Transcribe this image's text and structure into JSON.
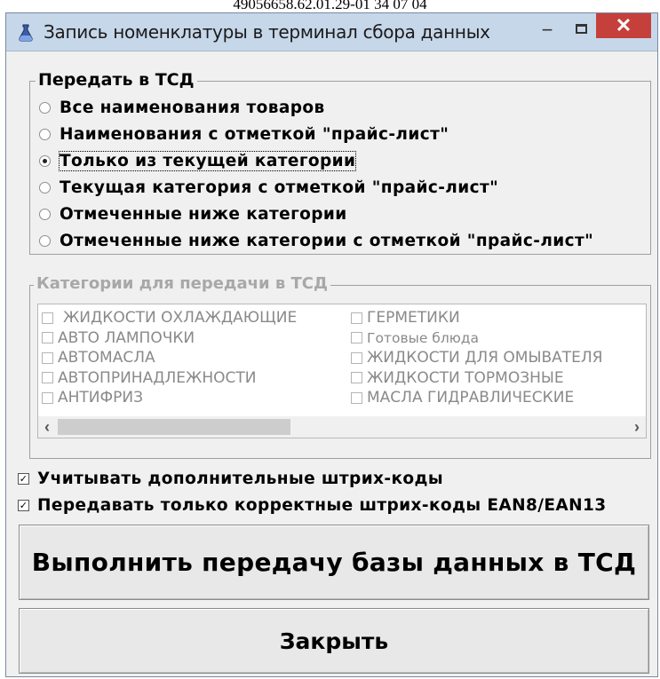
{
  "caption": "49056658.62.01.29-01 34 07 04",
  "window": {
    "title": "Запись номенклатуры в терминал сбора данных",
    "minimize_glyph": "−",
    "close_glyph": "✕",
    "app_icon": "flask-icon"
  },
  "transfer_group": {
    "legend": "Передать в ТСД",
    "options": [
      {
        "label": "Все наименования товаров",
        "selected": false
      },
      {
        "label": "Наименования с отметкой \"прайс-лист\"",
        "selected": false
      },
      {
        "label": "Только из текущей категории",
        "selected": true
      },
      {
        "label": "Текущая категория с отметкой \"прайс-лист\"",
        "selected": false
      },
      {
        "label": "Отмеченные ниже категории",
        "selected": false
      },
      {
        "label": "Отмеченные ниже категории с отметкой \"прайс-лист\"",
        "selected": false
      }
    ]
  },
  "categories_group": {
    "legend": "Категории для передачи в ТСД",
    "column1": [
      "ЖИДКОСТИ ОХЛАЖДАЮЩИЕ",
      "АВТО ЛАМПОЧКИ",
      "АВТОМАСЛА",
      "АВТОПРИНАДЛЕЖНОСТИ",
      "АНТИФРИЗ"
    ],
    "column2": [
      "ГЕРМЕТИКИ",
      "Готовые блюда",
      "ЖИДКОСТИ ДЛЯ ОМЫВАТЕЛЯ",
      "ЖИДКОСТИ ТОРМОЗНЫЕ",
      "МАСЛА ГИДРАВЛИЧЕСКИЕ"
    ],
    "scroll_left": "‹",
    "scroll_right": "›"
  },
  "options": {
    "extra_barcodes": {
      "label": "Учитывать дополнительные штрих-коды",
      "checked": true
    },
    "only_valid_barcodes": {
      "label": "Передавать только корректные штрих-коды EAN8/EAN13",
      "checked": true
    },
    "check_glyph": "✓"
  },
  "buttons": {
    "transfer": "Выполнить передачу базы данных в ТСД",
    "close": "Закрыть"
  },
  "colors": {
    "titlebar": "#c7d7ea",
    "close_button": "#c6403b",
    "window_bg": "#f0f0f0",
    "disabled_text": "#a8a8a8"
  }
}
